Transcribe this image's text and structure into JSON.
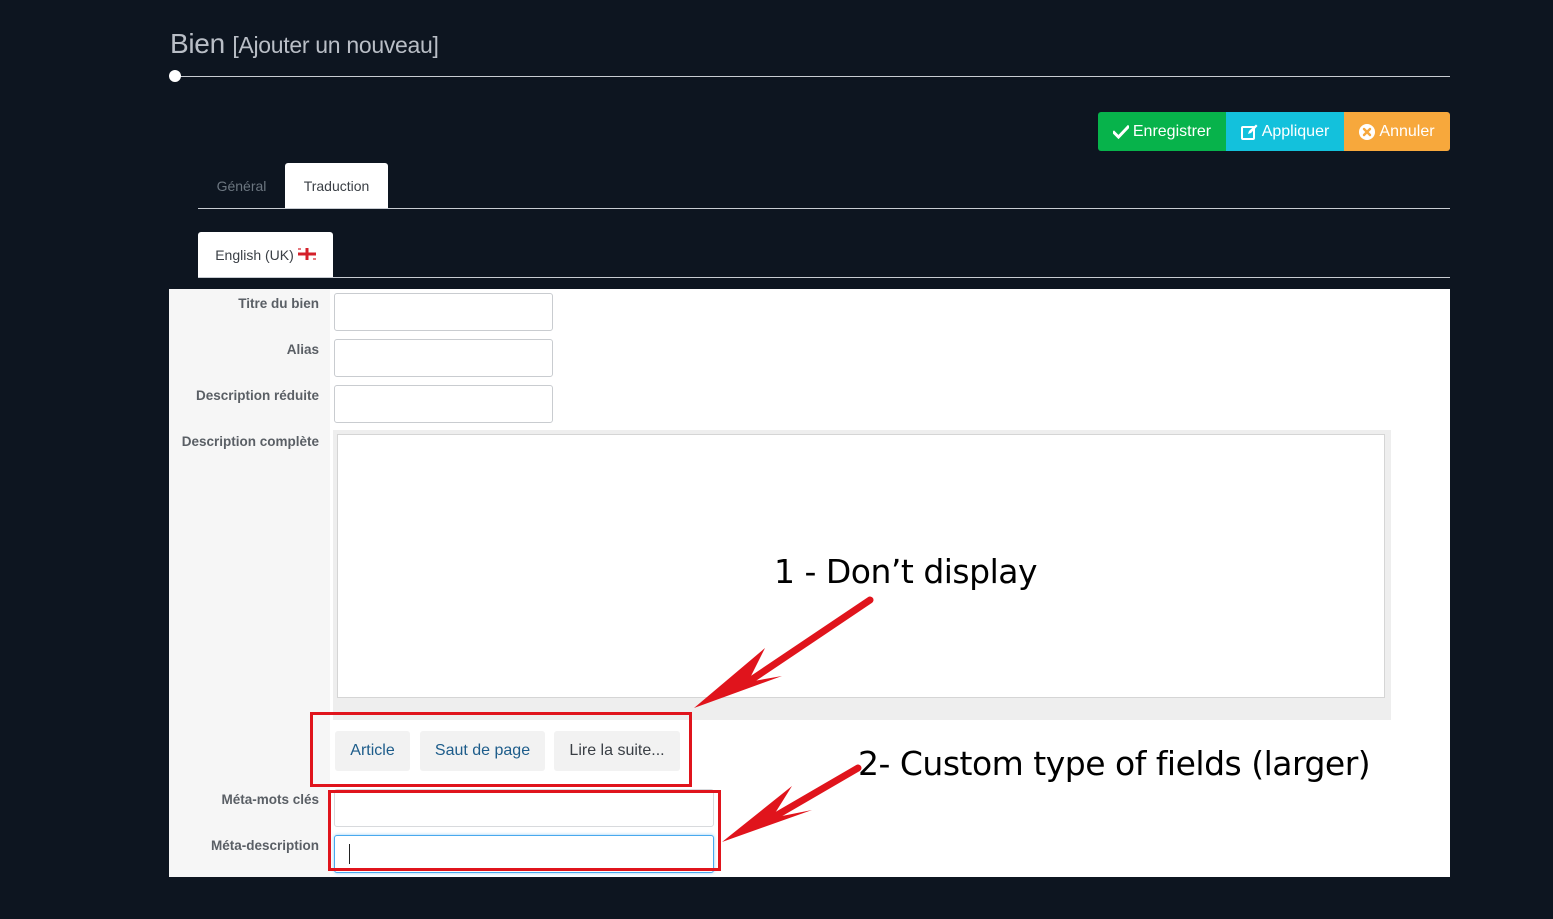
{
  "header": {
    "title": "Bien",
    "subtitle": "[Ajouter un nouveau]"
  },
  "toolbar": {
    "save_label": "Enregistrer",
    "apply_label": "Appliquer",
    "cancel_label": "Annuler",
    "save_icon": "check-icon",
    "apply_icon": "edit-icon",
    "cancel_icon": "close-circle-icon",
    "colors": {
      "save": "#07b34b",
      "apply": "#13c1dc",
      "cancel": "#f7a83c"
    }
  },
  "tabs": [
    {
      "label": "Général",
      "active": false
    },
    {
      "label": "Traduction",
      "active": true
    }
  ],
  "language_tab": {
    "label": "English (UK)",
    "flag_icon": "uk-flag-icon"
  },
  "form": {
    "fields": [
      {
        "label": "Titre du bien",
        "value": ""
      },
      {
        "label": "Alias",
        "value": ""
      },
      {
        "label": "Description réduite",
        "value": ""
      },
      {
        "label": "Description complète",
        "value": ""
      },
      {
        "label": "Méta-mots clés",
        "value": ""
      },
      {
        "label": "Méta-description",
        "value": ""
      }
    ],
    "editor_buttons": [
      "Article",
      "Saut de page",
      "Lire la suite..."
    ]
  },
  "annotations": {
    "note1": "1 - Don’t display",
    "note2": "2- Custom type of fields (larger)",
    "color": "#e0141c"
  }
}
